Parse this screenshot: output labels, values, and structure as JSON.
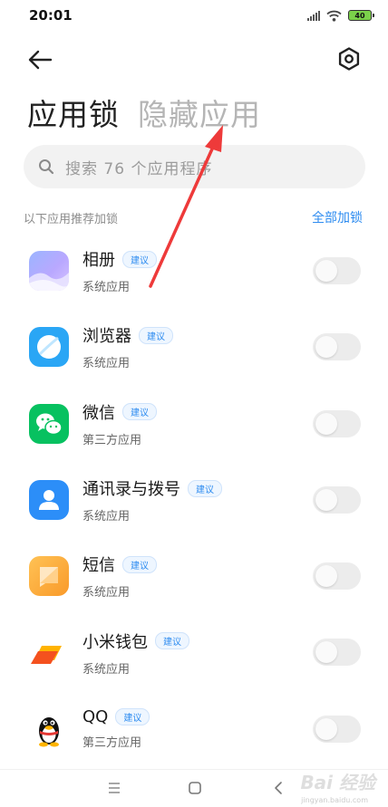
{
  "status_bar": {
    "time": "20:01",
    "battery": "40"
  },
  "header": {
    "back_icon": "back-arrow-icon",
    "settings_icon": "gear-icon"
  },
  "tabs": [
    {
      "label": "应用锁",
      "active": true
    },
    {
      "label": "隐藏应用",
      "active": false
    }
  ],
  "search": {
    "placeholder": "搜索 76 个应用程序",
    "icon": "search-icon"
  },
  "section": {
    "title": "以下应用推荐加锁",
    "action": "全部加锁"
  },
  "apps": [
    {
      "name": "相册",
      "badge": "建议",
      "subtitle": "系统应用",
      "icon": "gallery-icon",
      "locked": false
    },
    {
      "name": "浏览器",
      "badge": "建议",
      "subtitle": "系统应用",
      "icon": "browser-icon",
      "locked": false
    },
    {
      "name": "微信",
      "badge": "建议",
      "subtitle": "第三方应用",
      "icon": "wechat-icon",
      "locked": false
    },
    {
      "name": "通讯录与拨号",
      "badge": "建议",
      "subtitle": "系统应用",
      "icon": "contacts-icon",
      "locked": false
    },
    {
      "name": "短信",
      "badge": "建议",
      "subtitle": "系统应用",
      "icon": "messages-icon",
      "locked": false
    },
    {
      "name": "小米钱包",
      "badge": "建议",
      "subtitle": "系统应用",
      "icon": "wallet-icon",
      "locked": false
    },
    {
      "name": "QQ",
      "badge": "建议",
      "subtitle": "第三方应用",
      "icon": "qq-icon",
      "locked": false
    }
  ],
  "nav_bar": {
    "menu_icon": "menu-icon",
    "home_icon": "home-icon",
    "back_icon": "nav-back-icon"
  },
  "watermark": {
    "text": "Bai 经验",
    "url": "jingyan.baidu.com"
  },
  "colors": {
    "accent": "#2e8cf0",
    "arrow": "#ee3a3a"
  }
}
